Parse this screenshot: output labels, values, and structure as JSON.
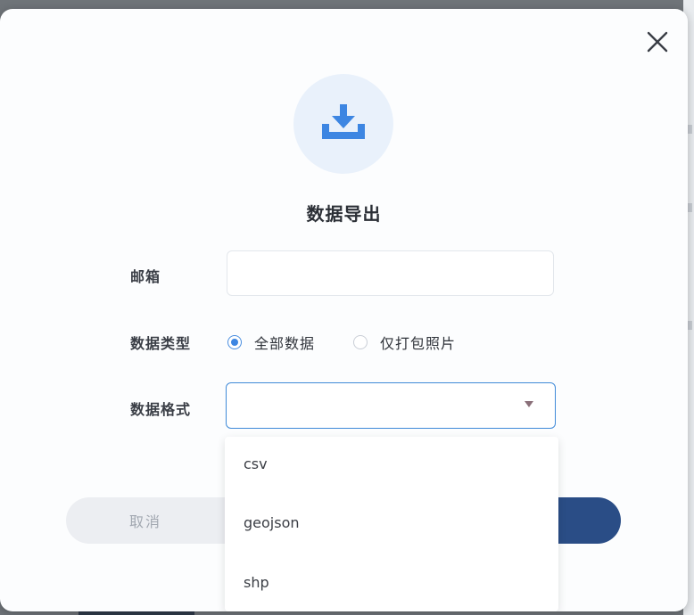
{
  "dialog": {
    "title": "数据导出",
    "icon": "download-tray-icon",
    "close_icon": "close-icon",
    "accent_color": "#3d86e2"
  },
  "form": {
    "email": {
      "label": "邮箱",
      "value": "",
      "placeholder": ""
    },
    "data_type": {
      "label": "数据类型",
      "options": [
        {
          "label": "全部数据",
          "selected": true
        },
        {
          "label": "仅打包照片",
          "selected": false
        }
      ]
    },
    "data_format": {
      "label": "数据格式",
      "selected_value": "",
      "options": [
        "csv",
        "geojson",
        "shp"
      ]
    }
  },
  "actions": {
    "cancel_label": "取消",
    "confirm_label": ""
  }
}
